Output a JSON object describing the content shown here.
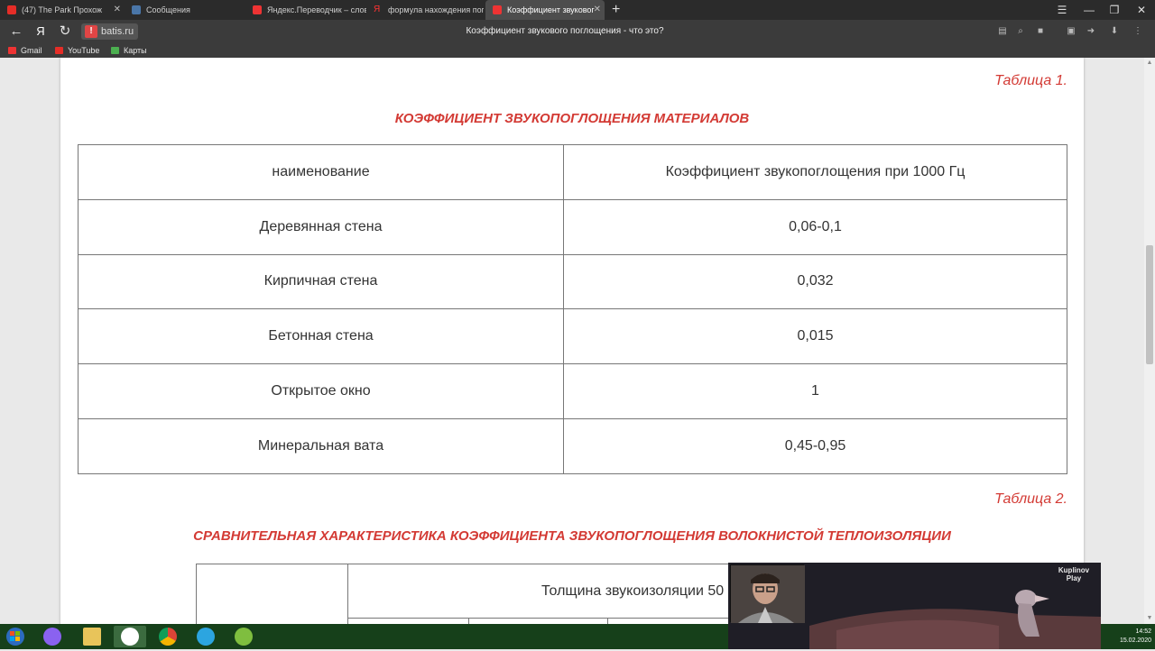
{
  "browser": {
    "tabs": [
      {
        "label": "(47) The Park Прохож",
        "icon": "youtube-icon",
        "color": "#e52d27"
      },
      {
        "label": "Сообщения",
        "icon": "vk-messages-icon",
        "color": "#4a76a8"
      },
      {
        "label": "Яндекс.Переводчик – слов",
        "icon": "yandex-translate-icon",
        "color": "#e33"
      },
      {
        "label": "формула нахождения пог",
        "icon": "yandex-icon",
        "color": "#f33"
      },
      {
        "label": "Коэффициент звуковог",
        "icon": "batis-site-icon",
        "color": "#e33",
        "active": true
      }
    ],
    "site": "batis.ru",
    "page_title": "Коэффициент звукового поглощения - что это?",
    "bookmarks": [
      {
        "label": "Gmail",
        "icon": "gmail-icon",
        "color": "#e33"
      },
      {
        "label": "YouTube",
        "icon": "youtube-icon",
        "color": "#e52d27"
      },
      {
        "label": "Карты",
        "icon": "maps-icon",
        "color": "#4caf50"
      }
    ]
  },
  "content": {
    "table1_caption": "Таблица 1.",
    "table1_heading": "КОЭФФИЦИЕНТ ЗВУКОПОГЛОЩЕНИЯ МАТЕРИАЛОВ",
    "table1_headers": [
      "наименование",
      "Коэффициент звукопоглощения при 1000 Гц"
    ],
    "table1_rows": [
      [
        "Деревянная стена",
        "0,06-0,1"
      ],
      [
        "Кирпичная стена",
        "0,032"
      ],
      [
        "Бетонная стена",
        "0,015"
      ],
      [
        "Открытое окно",
        "1"
      ],
      [
        "Минеральная вата",
        "0,45-0,95"
      ]
    ],
    "table2_caption": "Таблица 2.",
    "table2_heading": "СРАВНИТЕЛЬНАЯ ХАРАКТЕРИСТИКА КОЭФФИЦИЕНТА ЗВУКОПОГЛОЩЕНИЯ ВОЛОКНИСТОЙ ТЕПЛОИЗОЛЯЦИИ",
    "table2_header_partial": "Толщина звукоизоляции 50"
  },
  "taskbar": {
    "time": "14:52",
    "date": "15.02.2020"
  },
  "webcam": {
    "logo": "Kuplinov Play"
  },
  "colors": {
    "accent_red": "#d33a34",
    "chrome_dark": "#2b2b2b",
    "taskbar_green": "#16401a"
  }
}
